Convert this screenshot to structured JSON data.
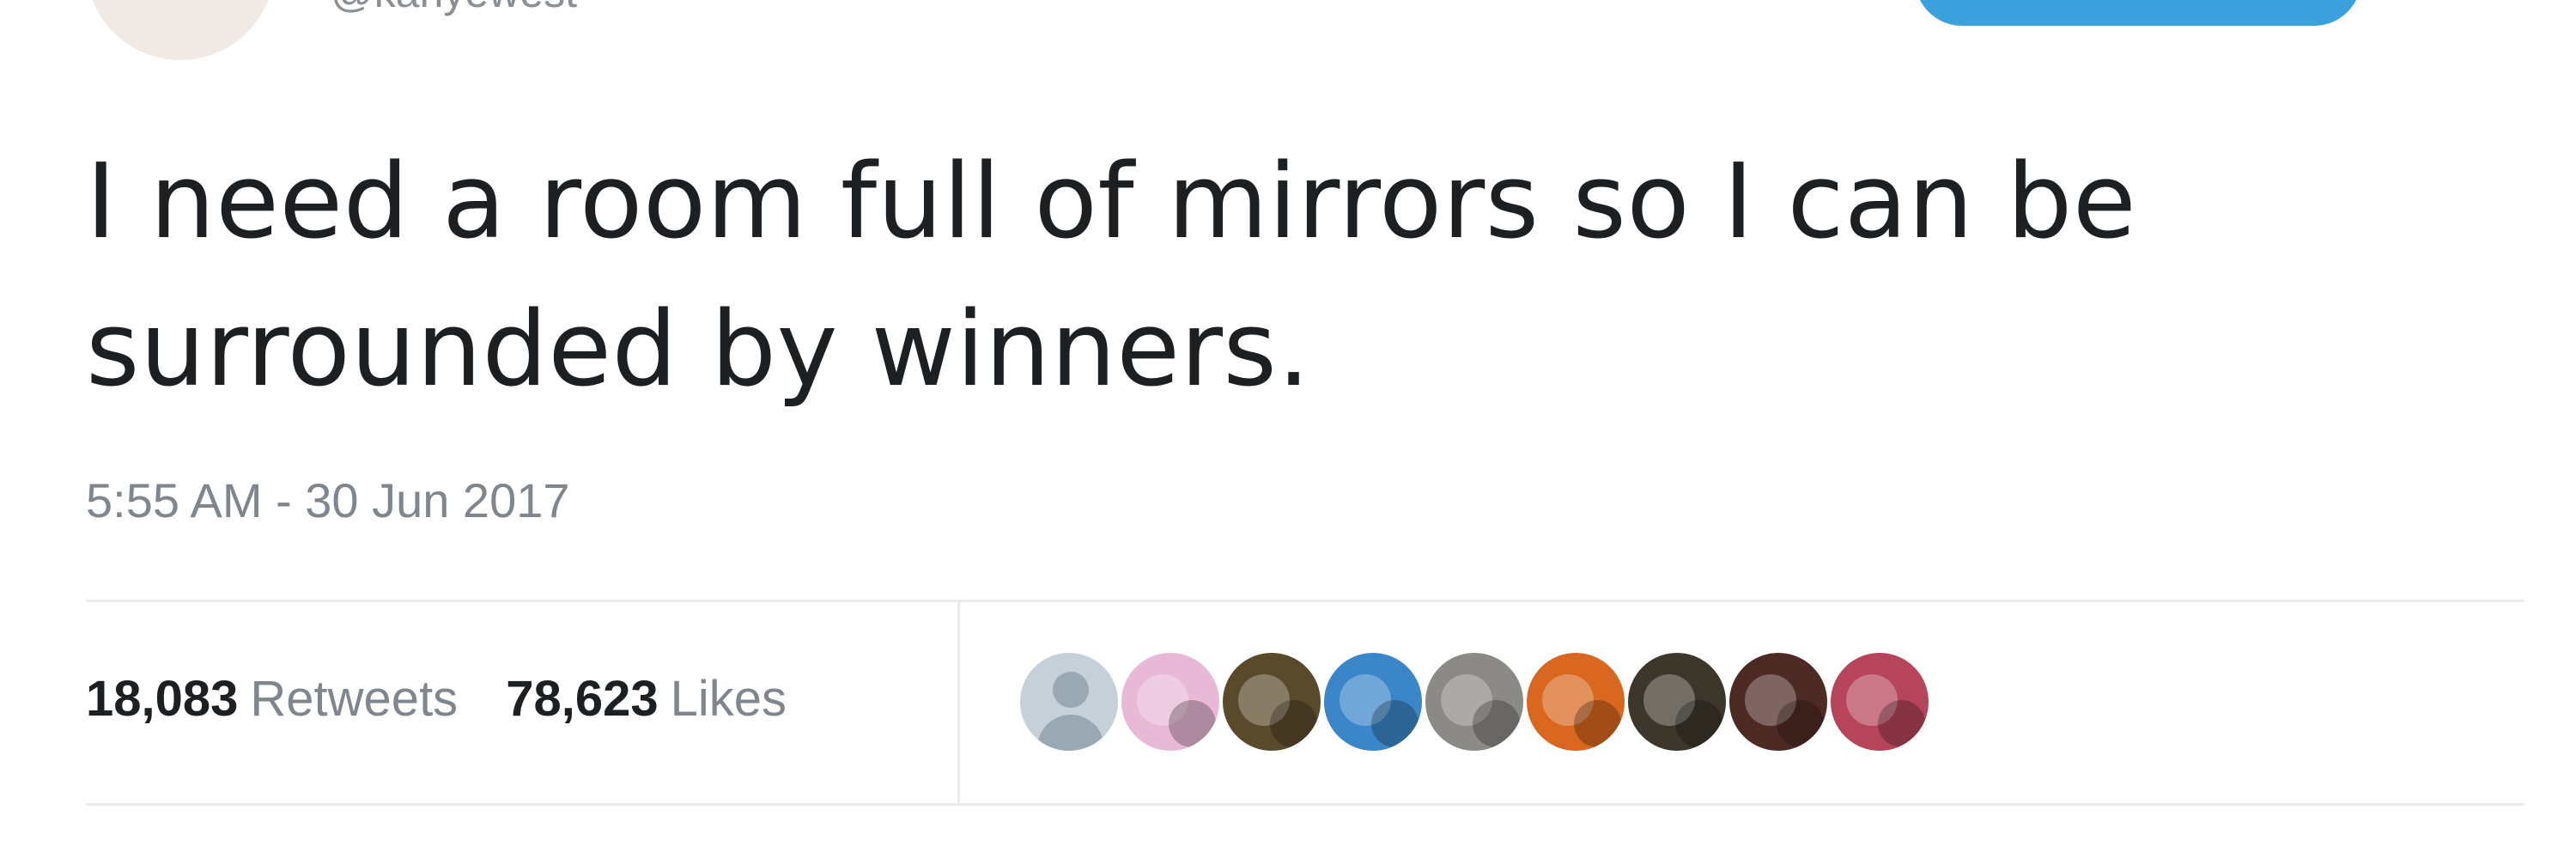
{
  "profile": {
    "handle": "@kanyewest"
  },
  "tweet": {
    "text_line1": "I need a room full of mirrors so I can be",
    "text_line2": "surrounded by winners.",
    "timestamp": "5:55 AM - 30 Jun 2017"
  },
  "stats": {
    "retweets_count": "18,083",
    "retweets_label": "Retweets",
    "likes_count": "78,623",
    "likes_label": "Likes"
  },
  "colors": {
    "follow_button": "#3aa1dd",
    "text": "#1c2022",
    "muted": "#7f868d"
  },
  "likers": [
    {
      "icon": "default-avatar-icon",
      "bg": "#c6d0d8"
    },
    {
      "icon": "user-avatar-pink",
      "bg": "#e8b9d6"
    },
    {
      "icon": "user-avatar-crowd",
      "bg": "#5a4a2c"
    },
    {
      "icon": "user-avatar-blue",
      "bg": "#3b86c9"
    },
    {
      "icon": "user-avatar-gray",
      "bg": "#8c8a86"
    },
    {
      "icon": "user-avatar-orange",
      "bg": "#d9671f"
    },
    {
      "icon": "user-avatar-dark",
      "bg": "#3d362b"
    },
    {
      "icon": "user-avatar-flag-dark",
      "bg": "#4e2a25"
    },
    {
      "icon": "user-avatar-flag",
      "bg": "#b6445a"
    }
  ]
}
